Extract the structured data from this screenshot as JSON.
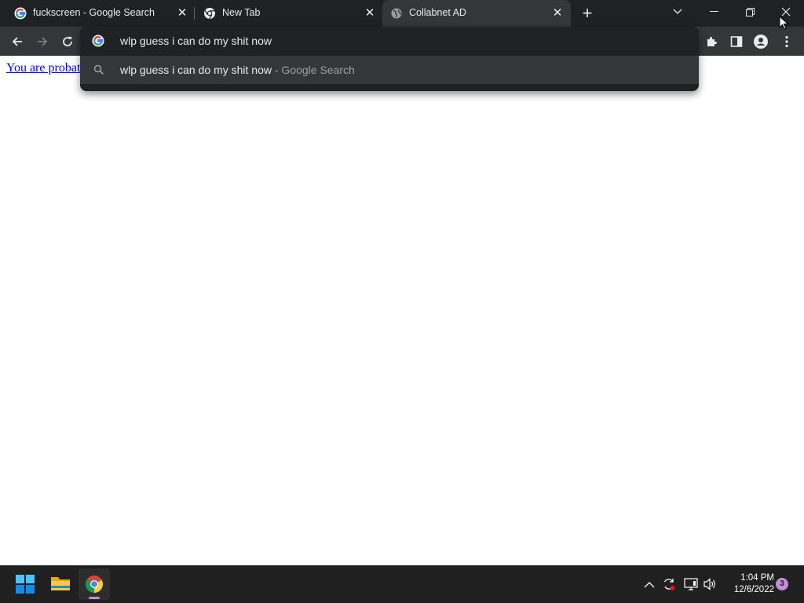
{
  "browser": {
    "tabs": [
      {
        "title": "fuckscreen - Google Search",
        "icon": "google-icon",
        "active": false
      },
      {
        "title": "New Tab",
        "icon": "chrome-icon",
        "active": false
      },
      {
        "title": "Collabnet AD",
        "icon": "globe-icon",
        "active": true
      }
    ],
    "new_tab_symbol": "+",
    "omnibox": {
      "value": "wlp guess i can do my shit now",
      "suggestion": {
        "query": "wlp guess i can do my shit now",
        "source": " - Google Search"
      }
    }
  },
  "page": {
    "link_text": "You are probat"
  },
  "taskbar": {
    "time": "1:04 PM",
    "date": "12/6/2022",
    "notification_count": "3"
  },
  "colors": {
    "tabstrip_bg": "#202124",
    "toolbar_bg": "#35363a",
    "taskbar_bg": "#202020",
    "link": "#0000ee",
    "notification_badge": "#c68bd8"
  }
}
